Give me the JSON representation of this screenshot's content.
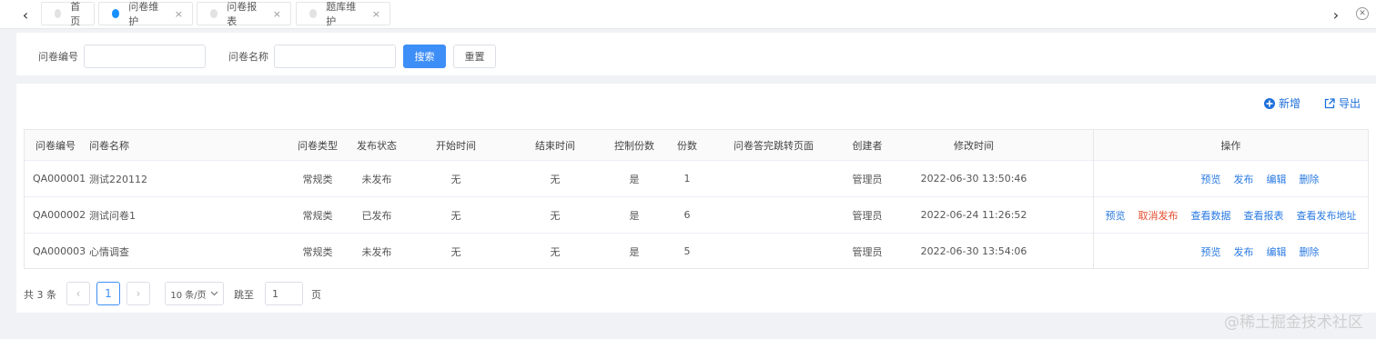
{
  "tabs": [
    {
      "label": "首页",
      "closable": false,
      "active": false
    },
    {
      "label": "问卷维护",
      "closable": true,
      "active": true
    },
    {
      "label": "问卷报表",
      "closable": true,
      "active": false
    },
    {
      "label": "题库维护",
      "closable": true,
      "active": false
    }
  ],
  "tab_close_glyph": "×",
  "nav": {
    "prev": "‹",
    "next": "›",
    "close_all": "✕"
  },
  "search": {
    "code_label": "问卷编号",
    "code_value": "",
    "name_label": "问卷名称",
    "name_value": "",
    "search_button": "搜索",
    "reset_button": "重置"
  },
  "toolbar": {
    "add_label": "新增",
    "export_label": "导出"
  },
  "table": {
    "columns": [
      "问卷编号",
      "问卷名称",
      "问卷类型",
      "发布状态",
      "开始时间",
      "结束时间",
      "控制份数",
      "份数",
      "问卷答完跳转页面",
      "创建者",
      "修改时间",
      "操作"
    ],
    "rows": [
      {
        "code": "QA000001",
        "name": "测试220112",
        "type": "常规类",
        "status": "未发布",
        "start": "无",
        "end": "无",
        "control": "是",
        "count": "1",
        "redirect": "",
        "creator": "管理员",
        "modified": "2022-06-30 13:50:46",
        "actions": [
          "预览",
          "发布",
          "编辑",
          "删除"
        ]
      },
      {
        "code": "QA000002",
        "name": "测试问卷1",
        "type": "常规类",
        "status": "已发布",
        "start": "无",
        "end": "无",
        "control": "是",
        "count": "6",
        "redirect": "",
        "creator": "管理员",
        "modified": "2022-06-24 11:26:52",
        "actions": [
          "预览",
          "取消发布",
          "查看数据",
          "查看报表",
          "查看发布地址"
        ]
      },
      {
        "code": "QA000003",
        "name": "心情调查",
        "type": "常规类",
        "status": "未发布",
        "start": "无",
        "end": "无",
        "control": "是",
        "count": "5",
        "redirect": "",
        "creator": "管理员",
        "modified": "2022-06-30 13:54:06",
        "actions": [
          "预览",
          "发布",
          "编辑",
          "删除"
        ]
      }
    ]
  },
  "pagination": {
    "total": "共 3 条",
    "prev": "‹",
    "current": "1",
    "next": "›",
    "page_size": "10 条/页",
    "jump_label": "跳至",
    "jump_value": "1",
    "page_suffix": "页"
  },
  "watermark": "@稀土掘金技术社区",
  "colors": {
    "primary": "#3e8ef7",
    "link": "#2a7ae2",
    "danger": "#e34d2f"
  }
}
